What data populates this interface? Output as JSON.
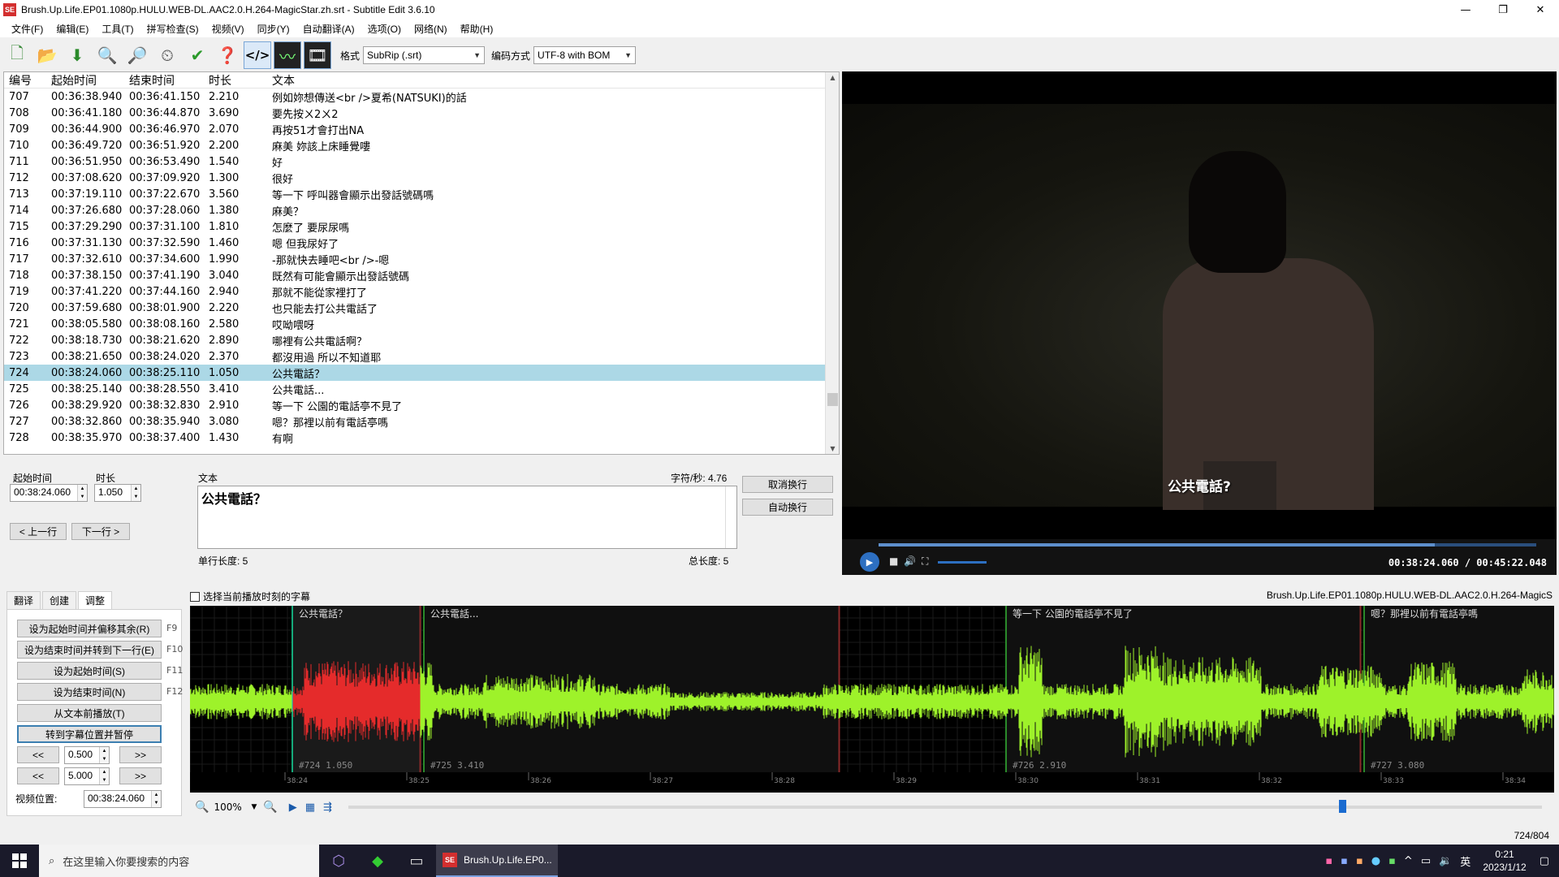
{
  "window": {
    "title": "Brush.Up.Life.EP01.1080p.HULU.WEB-DL.AAC2.0.H.264-MagicStar.zh.srt - Subtitle Edit 3.6.10",
    "icon_text": "SE"
  },
  "menu": [
    "文件(F)",
    "编辑(E)",
    "工具(T)",
    "拼写检查(S)",
    "视频(V)",
    "同步(Y)",
    "自动翻译(A)",
    "选项(O)",
    "网络(N)",
    "帮助(H)"
  ],
  "toolbar": {
    "format_label": "格式",
    "format_value": "SubRip (.srt)",
    "encoding_label": "编码方式",
    "encoding_value": "UTF-8 with BOM"
  },
  "list": {
    "columns": [
      "编号",
      "起始时间",
      "结束时间",
      "时长",
      "文本"
    ],
    "rows": [
      {
        "no": "707",
        "start": "00:36:38.940",
        "end": "00:36:41.150",
        "dur": "2.210",
        "text": "例如妳想傳送<br />夏希(NATSUKI)的話"
      },
      {
        "no": "708",
        "start": "00:36:41.180",
        "end": "00:36:44.870",
        "dur": "3.690",
        "text": "要先按ㄨ2ㄨ2"
      },
      {
        "no": "709",
        "start": "00:36:44.900",
        "end": "00:36:46.970",
        "dur": "2.070",
        "text": "再按51才會打出NA"
      },
      {
        "no": "710",
        "start": "00:36:49.720",
        "end": "00:36:51.920",
        "dur": "2.200",
        "text": "麻美 妳該上床睡覺嘍"
      },
      {
        "no": "711",
        "start": "00:36:51.950",
        "end": "00:36:53.490",
        "dur": "1.540",
        "text": "好"
      },
      {
        "no": "712",
        "start": "00:37:08.620",
        "end": "00:37:09.920",
        "dur": "1.300",
        "text": "很好"
      },
      {
        "no": "713",
        "start": "00:37:19.110",
        "end": "00:37:22.670",
        "dur": "3.560",
        "text": "等一下 呼叫器會顯示出發話號碼嗎"
      },
      {
        "no": "714",
        "start": "00:37:26.680",
        "end": "00:37:28.060",
        "dur": "1.380",
        "text": "麻美？"
      },
      {
        "no": "715",
        "start": "00:37:29.290",
        "end": "00:37:31.100",
        "dur": "1.810",
        "text": "怎麼了 要尿尿嗎"
      },
      {
        "no": "716",
        "start": "00:37:31.130",
        "end": "00:37:32.590",
        "dur": "1.460",
        "text": "嗯 但我尿好了"
      },
      {
        "no": "717",
        "start": "00:37:32.610",
        "end": "00:37:34.600",
        "dur": "1.990",
        "text": "-那就快去睡吧<br />-嗯"
      },
      {
        "no": "718",
        "start": "00:37:38.150",
        "end": "00:37:41.190",
        "dur": "3.040",
        "text": "既然有可能會顯示出發話號碼"
      },
      {
        "no": "719",
        "start": "00:37:41.220",
        "end": "00:37:44.160",
        "dur": "2.940",
        "text": "那就不能從家裡打了"
      },
      {
        "no": "720",
        "start": "00:37:59.680",
        "end": "00:38:01.900",
        "dur": "2.220",
        "text": "也只能去打公共電話了"
      },
      {
        "no": "721",
        "start": "00:38:05.580",
        "end": "00:38:08.160",
        "dur": "2.580",
        "text": "哎呦喂呀"
      },
      {
        "no": "722",
        "start": "00:38:18.730",
        "end": "00:38:21.620",
        "dur": "2.890",
        "text": "哪裡有公共電話啊？"
      },
      {
        "no": "723",
        "start": "00:38:21.650",
        "end": "00:38:24.020",
        "dur": "2.370",
        "text": "都沒用過 所以不知道耶"
      },
      {
        "no": "724",
        "start": "00:38:24.060",
        "end": "00:38:25.110",
        "dur": "1.050",
        "text": "公共電話？",
        "selected": true
      },
      {
        "no": "725",
        "start": "00:38:25.140",
        "end": "00:38:28.550",
        "dur": "3.410",
        "text": "公共電話..."
      },
      {
        "no": "726",
        "start": "00:38:29.920",
        "end": "00:38:32.830",
        "dur": "2.910",
        "text": "等一下 公園的電話亭不見了"
      },
      {
        "no": "727",
        "start": "00:38:32.860",
        "end": "00:38:35.940",
        "dur": "3.080",
        "text": "嗯？那裡以前有電話亭嗎"
      },
      {
        "no": "728",
        "start": "00:38:35.970",
        "end": "00:38:37.400",
        "dur": "1.430",
        "text": "有啊"
      }
    ]
  },
  "editor": {
    "start_label": "起始时间",
    "start_value": "00:38:24.060",
    "duration_label": "时长",
    "duration_value": "1.050",
    "prev_button": "< 上一行",
    "next_button": "下一行 >",
    "text_label": "文本",
    "cps": "字符/秒: 4.76",
    "text_value": "公共電話？",
    "unbreak_button": "取消换行",
    "autobreak_button": "自动换行",
    "line_length": "单行长度: 5",
    "total_length": "总长度: 5"
  },
  "video": {
    "subtitle": "公共電話?",
    "time": "00:38:24.060 / 00:45:22.048",
    "progress": 0.846
  },
  "tabs": [
    "翻译",
    "创建",
    "调整"
  ],
  "adjust": {
    "buttons": [
      {
        "label": "设为起始时间并偏移其余(R)",
        "key": "F9"
      },
      {
        "label": "设为结束时间并转到下一行(E)",
        "key": "F10"
      },
      {
        "label": "设为起始时间(S)",
        "key": "F11"
      },
      {
        "label": "设为结束时间(N)",
        "key": "F12"
      },
      {
        "label": "从文本前播放(T)",
        "key": ""
      },
      {
        "label": "转到字幕位置并暂停",
        "key": ""
      }
    ],
    "step1": "0.500",
    "step2": "5.000",
    "back": "<<",
    "fwd": ">>",
    "video_pos_label": "视频位置:",
    "video_pos_value": "00:38:24.060"
  },
  "waveform": {
    "checkbox_label": "选择当前播放时刻的字幕",
    "filename": "Brush.Up.Life.EP01.1080p.HULU.WEB-DL.AAC2.0.H.264-MagicS",
    "subs": [
      {
        "text": "公共電話？",
        "info": "#724  1.050"
      },
      {
        "text": "公共電話...",
        "info": "#725  3.410"
      },
      {
        "text": "等一下 公園的電話亭不見了",
        "info": "#726  2.910"
      },
      {
        "text": "嗯？那裡以前有電話亭嗎",
        "info": "#727  3.080"
      }
    ],
    "ticks": [
      "38:24",
      "38:25",
      "38:26",
      "38:27",
      "38:28",
      "38:29",
      "38:30",
      "38:31",
      "38:32",
      "38:33",
      "38:34"
    ],
    "zoom": "100%"
  },
  "status": {
    "count": "724/804"
  },
  "taskbar": {
    "search_placeholder": "在这里输入你要搜索的内容",
    "active_app": "Brush.Up.Life.EP0...",
    "ime": "英",
    "time": "0:21",
    "date": "2023/1/12"
  }
}
